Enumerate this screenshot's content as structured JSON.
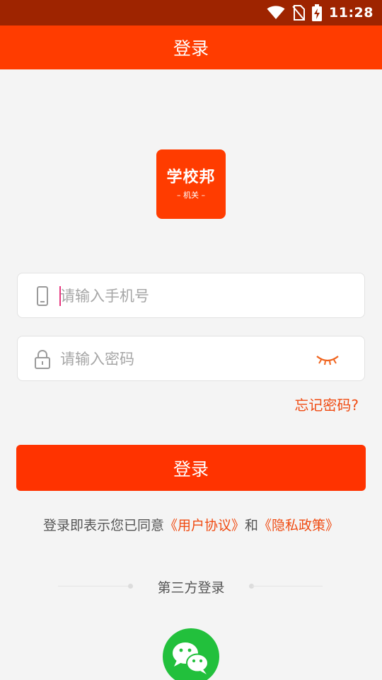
{
  "status_bar": {
    "time": "11:28",
    "icons": [
      "wifi-icon",
      "no-sim-icon",
      "battery-charging-icon"
    ]
  },
  "header": {
    "title": "登录"
  },
  "logo": {
    "main_text": "学校邦",
    "sub_text": "– 机关 –"
  },
  "form": {
    "phone": {
      "placeholder": "请输入手机号",
      "value": "",
      "icon": "phone-icon"
    },
    "password": {
      "placeholder": "请输入密码",
      "value": "",
      "icon": "lock-icon",
      "toggle_icon": "eye-closed-icon"
    },
    "forgot_label": "忘记密码?",
    "login_label": "登录"
  },
  "agreement": {
    "prefix": "登录即表示您已同意",
    "user_agreement": "《用户协议》",
    "and": "和",
    "privacy_policy": "《隐私政策》"
  },
  "third_party": {
    "label": "第三方登录",
    "providers": [
      "wechat-icon"
    ]
  },
  "colors": {
    "primary": "#ff3c00",
    "status_bar": "#9e2400",
    "link": "#f04b12",
    "wechat": "#22c03c",
    "background": "#f4f4f4"
  }
}
